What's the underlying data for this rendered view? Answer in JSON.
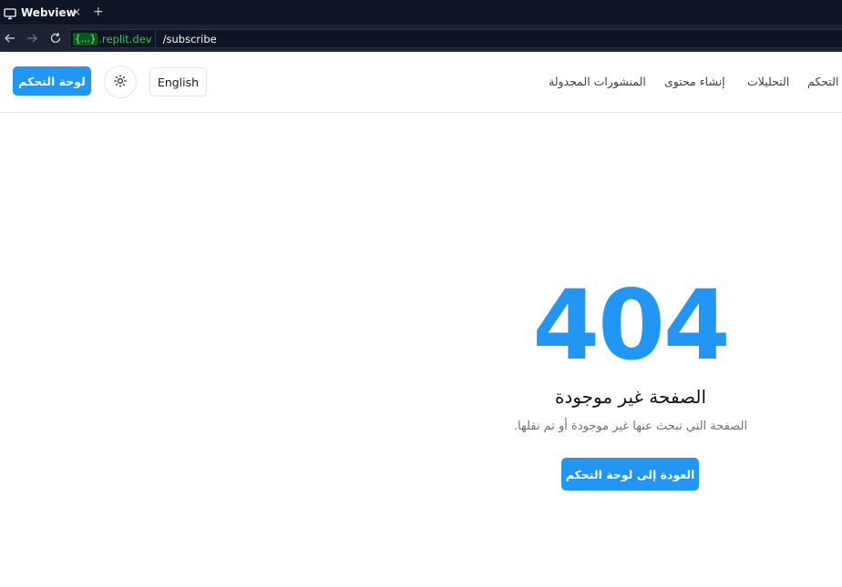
{
  "browser": {
    "tab_title": "Webview",
    "tab_close": "×",
    "new_tab": "+",
    "url_badge": "{...}",
    "url_host_suffix": ".replit.dev",
    "url_path": "/subscribe"
  },
  "header": {
    "dashboard_button": "لوحة التحكم",
    "language_button": "English",
    "nav": {
      "scheduled_posts": "المنشورات المجدولة",
      "create_content": "إنشاء محتوى",
      "analytics": "التحليلات",
      "dashboard": "التحكم"
    }
  },
  "error": {
    "code": "404",
    "title": "الصفحة غير موجودة",
    "description": "الصفحة التي تبحث عنها غير موجودة أو تم نقلها.",
    "back_button": "العودة إلى لوحة التحكم"
  },
  "colors": {
    "accent": "#2196f3",
    "chrome_bg": "#0e1525",
    "url_host": "#3ec458"
  },
  "icons": {
    "tab": "monitor-icon",
    "back": "arrow-left-icon",
    "forward": "arrow-right-icon",
    "reload": "reload-icon",
    "theme": "sun-icon"
  }
}
